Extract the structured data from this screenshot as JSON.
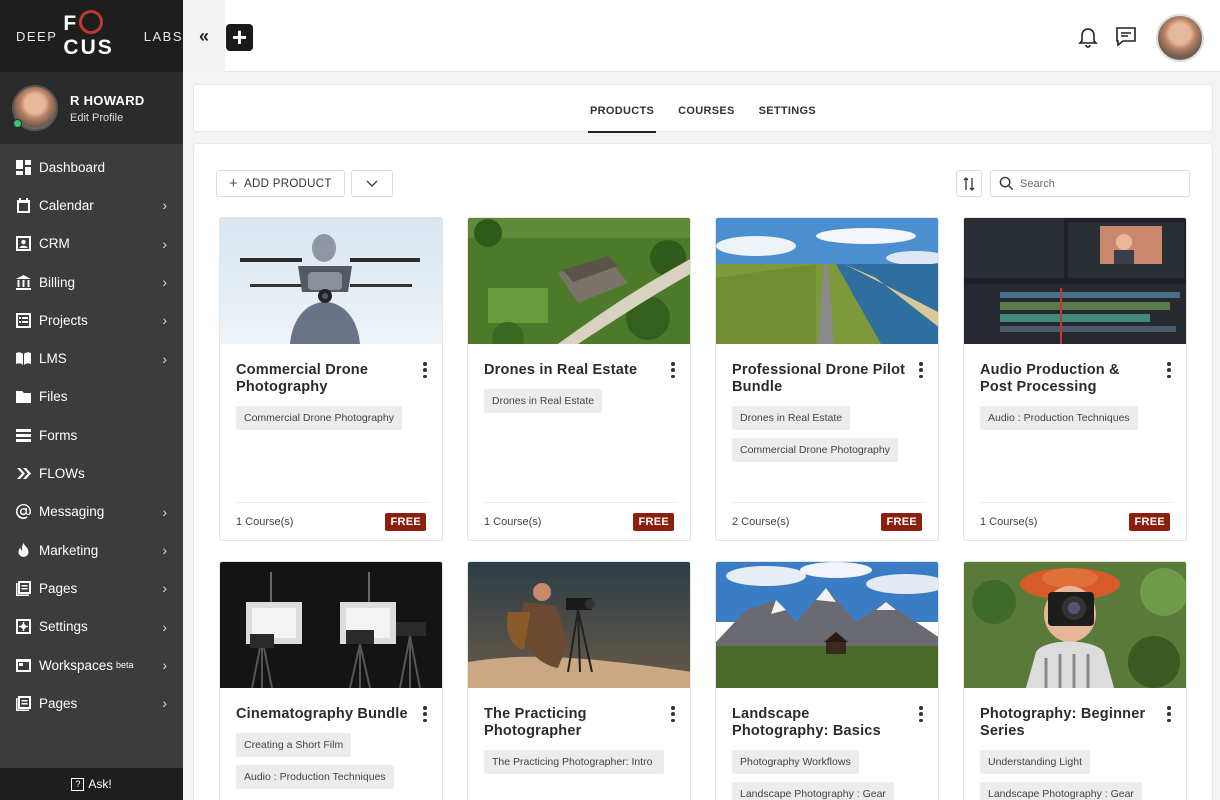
{
  "brand": {
    "word1": "DEEP",
    "word2_pre": "F",
    "word2_post": "CUS",
    "word3": "LABS"
  },
  "profile": {
    "name": "R HOWARD",
    "edit_label": "Edit Profile"
  },
  "nav": [
    {
      "label": "Dashboard",
      "icon": "dashboard-icon",
      "chevron": false
    },
    {
      "label": "Calendar",
      "icon": "calendar-icon",
      "chevron": true
    },
    {
      "label": "CRM",
      "icon": "crm-contact-icon",
      "chevron": true
    },
    {
      "label": "Billing",
      "icon": "bank-icon",
      "chevron": true
    },
    {
      "label": "Projects",
      "icon": "projects-list-icon",
      "chevron": true
    },
    {
      "label": "LMS",
      "icon": "book-icon",
      "chevron": true
    },
    {
      "label": "Files",
      "icon": "folder-icon",
      "chevron": false
    },
    {
      "label": "Forms",
      "icon": "forms-icon",
      "chevron": false
    },
    {
      "label": "FLOWs",
      "icon": "double-chevron-icon",
      "chevron": false
    },
    {
      "label": "Messaging",
      "icon": "at-sign-icon",
      "chevron": true
    },
    {
      "label": "Marketing",
      "icon": "flame-icon",
      "chevron": true
    },
    {
      "label": "Pages",
      "icon": "pages-icon",
      "chevron": true
    },
    {
      "label": "Settings",
      "icon": "settings-icon",
      "chevron": true
    },
    {
      "label": "Workspaces",
      "icon": "workspace-icon",
      "chevron": true,
      "sup": "beta"
    },
    {
      "label": "Pages",
      "icon": "pages-icon",
      "chevron": true
    }
  ],
  "ask_label": "Ask!",
  "topbar": {
    "collapse_glyph": "«",
    "add_glyph": "+"
  },
  "tabs": [
    "PRODUCTS",
    "COURSES",
    "SETTINGS"
  ],
  "toolbar": {
    "add_product_label": "ADD PRODUCT",
    "search_placeholder": "Search"
  },
  "products": [
    {
      "title": "Commercial Drone Photography",
      "tags": [
        "Commercial Drone Photography"
      ],
      "courses": "1 Course(s)",
      "price": "FREE"
    },
    {
      "title": "Drones in Real Estate",
      "tags": [
        "Drones in Real Estate"
      ],
      "courses": "1 Course(s)",
      "price": "FREE"
    },
    {
      "title": "Professional Drone Pilot Bundle",
      "tags": [
        "Drones in Real Estate",
        "Commercial Drone Photography"
      ],
      "courses": "2 Course(s)",
      "price": "FREE"
    },
    {
      "title": "Audio Production & Post Processing",
      "tags": [
        "Audio : Production Techniques"
      ],
      "courses": "1 Course(s)",
      "price": "FREE"
    },
    {
      "title": "Cinematography Bundle",
      "tags": [
        "Creating a Short Film",
        "Audio : Production Techniques"
      ]
    },
    {
      "title": "The Practicing Photographer",
      "tags": [
        "The Practicing Photographer: Intro"
      ]
    },
    {
      "title": "Landscape Photography: Basics",
      "tags": [
        "Photography Workflows",
        "Landscape Photography : Gear"
      ]
    },
    {
      "title": "Photography: Beginner Series",
      "tags": [
        "Understanding Light",
        "Landscape Photography : Gear"
      ]
    }
  ],
  "colors": {
    "sidebar": "#3c3c3c",
    "sidebar_dark": "#1e1e1e",
    "price_badge": "#8b1f10",
    "online": "#2ecc71"
  }
}
